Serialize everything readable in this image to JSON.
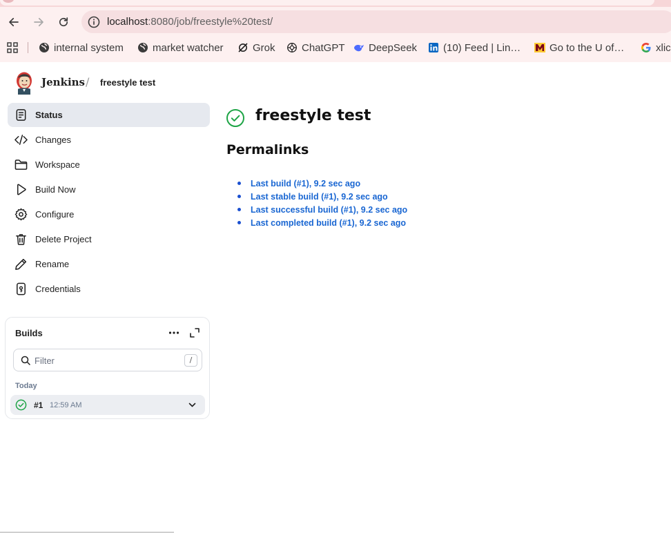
{
  "browser": {
    "url_host": "localhost",
    "url_path": ":8080/job/freestyle%20test/",
    "bookmarks": [
      {
        "label": "internal system",
        "icon": "globe-icon"
      },
      {
        "label": "market watcher",
        "icon": "globe-icon"
      },
      {
        "label": "Grok",
        "icon": "grok-icon"
      },
      {
        "label": "ChatGPT",
        "icon": "chatgpt-icon"
      },
      {
        "label": "DeepSeek",
        "icon": "deepseek-icon"
      },
      {
        "label": "(10) Feed | Lin…",
        "icon": "linkedin-icon"
      },
      {
        "label": "Go to the U of…",
        "icon": "umn-icon"
      },
      {
        "label": "xlic",
        "icon": "google-icon"
      }
    ]
  },
  "header": {
    "brand": "Jenkins",
    "separator": "/",
    "breadcrumb": "freestyle test"
  },
  "sidebar": {
    "items": [
      {
        "label": "Status",
        "icon": "status-doc-icon",
        "active": true
      },
      {
        "label": "Changes",
        "icon": "code-icon"
      },
      {
        "label": "Workspace",
        "icon": "folder-icon"
      },
      {
        "label": "Build Now",
        "icon": "play-icon"
      },
      {
        "label": "Configure",
        "icon": "gear-icon"
      },
      {
        "label": "Delete Project",
        "icon": "trash-icon"
      },
      {
        "label": "Rename",
        "icon": "pencil-icon"
      },
      {
        "label": "Credentials",
        "icon": "credentials-icon"
      }
    ]
  },
  "builds": {
    "title": "Builds",
    "filter_placeholder": "Filter",
    "filter_shortcut": "/",
    "group_label": "Today",
    "items": [
      {
        "number": "#1",
        "time": "12:59 AM",
        "status": "success"
      }
    ]
  },
  "main": {
    "title": "freestyle test",
    "status": "success",
    "permalinks_heading": "Permalinks",
    "permalinks": [
      "Last build (#1), 9.2 sec ago",
      "Last stable build (#1), 9.2 sec ago",
      "Last successful build (#1), 9.2 sec ago",
      "Last completed build (#1), 9.2 sec ago"
    ]
  },
  "colors": {
    "chrome_bg": "#fdf0f0",
    "omnibox_bg": "#f6dfe1",
    "active_item_bg": "#e6e9ef",
    "success_green": "#1ea446",
    "link_blue": "#1966d2"
  }
}
